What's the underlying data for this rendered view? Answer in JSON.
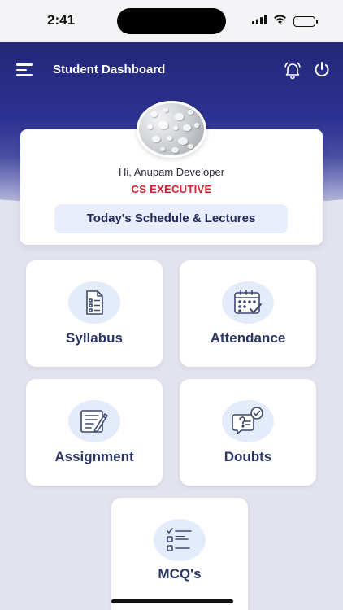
{
  "status_bar": {
    "time": "2:41"
  },
  "header": {
    "title": "Student Dashboard"
  },
  "profile": {
    "greeting": "Hi, Anupam Developer",
    "course": "CS EXECUTIVE",
    "schedule_button": "Today's Schedule & Lectures"
  },
  "tiles": [
    {
      "label": "Syllabus",
      "icon": "syllabus-icon"
    },
    {
      "label": "Attendance",
      "icon": "calendar-check-icon"
    },
    {
      "label": "Assignment",
      "icon": "assignment-icon"
    },
    {
      "label": "Doubts",
      "icon": "doubts-chat-icon"
    },
    {
      "label": "MCQ's",
      "icon": "mcq-checklist-icon"
    }
  ],
  "colors": {
    "header_dark": "#23287a",
    "accent_red": "#d0222e",
    "tile_text": "#2b3566",
    "icon_bg": "#e4ecfb"
  }
}
